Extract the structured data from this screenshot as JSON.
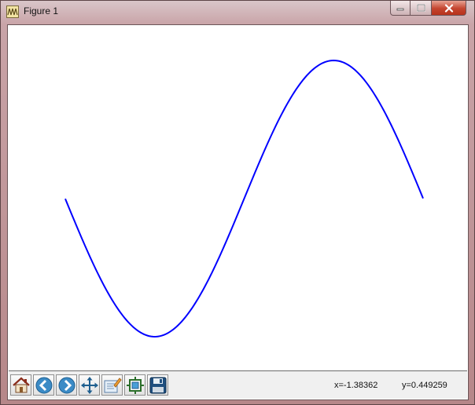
{
  "window": {
    "title": "Figure 1",
    "controls": [
      "minimize",
      "maximize",
      "close"
    ]
  },
  "toolbar": {
    "buttons": [
      {
        "name": "home",
        "icon": "home-icon"
      },
      {
        "name": "back",
        "icon": "back-arrow-icon"
      },
      {
        "name": "forward",
        "icon": "forward-arrow-icon"
      },
      {
        "name": "pan",
        "icon": "pan-arrows-icon"
      },
      {
        "name": "zoom",
        "icon": "zoom-rect-icon"
      },
      {
        "name": "subplots",
        "icon": "subplots-config-icon"
      },
      {
        "name": "save",
        "icon": "floppy-disk-icon"
      }
    ],
    "x_readout": "x=-1.38362",
    "y_readout": "y=0.449259"
  },
  "colors": {
    "line": "#0000ff",
    "canvas": "#ffffff",
    "toolbar_bg": "#f0f0f0",
    "close_button": "#c4452f"
  },
  "chart_data": {
    "type": "line",
    "title": "",
    "xlabel": "",
    "ylabel": "",
    "axes_visible": false,
    "grid": false,
    "series": [
      {
        "function": "sin",
        "x": [
          -3.14,
          -2.62,
          -2.09,
          -1.57,
          -1.05,
          -0.52,
          0.0,
          0.52,
          1.05,
          1.57,
          2.09,
          2.62,
          3.14
        ],
        "y": [
          0.0,
          -0.5,
          -0.866,
          -1.0,
          -0.866,
          -0.5,
          0.0,
          0.5,
          0.866,
          1.0,
          0.866,
          0.5,
          0.0
        ]
      }
    ],
    "xlim": [
      -3.14,
      3.14
    ],
    "ylim": [
      -1.0,
      1.0
    ]
  }
}
